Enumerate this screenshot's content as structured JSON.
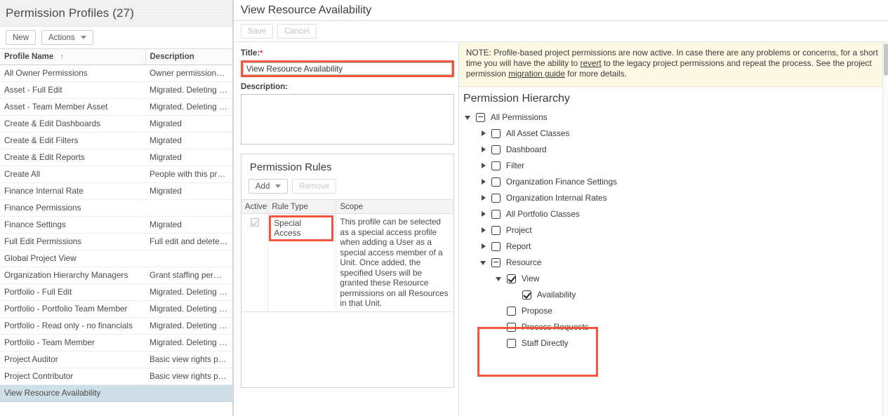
{
  "left": {
    "title": "Permission Profiles (27)",
    "toolbar": {
      "new_label": "New",
      "actions_label": "Actions"
    },
    "columns": {
      "name": "Profile Name",
      "description": "Description"
    },
    "sort_glyph": "↑",
    "rows": [
      {
        "name": "All Owner Permissions",
        "description": "Owner permissions that have been migrated and consolidated into a single profile."
      },
      {
        "name": "Asset - Full Edit",
        "description": "Migrated. Deleting this profile will result in asset sharing no longer working."
      },
      {
        "name": "Asset - Team Member Asset",
        "description": "Migrated. Deleting this profile will result in asset sharing no longer working."
      },
      {
        "name": "Create & Edit Dashboards",
        "description": "Migrated"
      },
      {
        "name": "Create & Edit Filters",
        "description": "Migrated"
      },
      {
        "name": "Create & Edit Reports",
        "description": "Migrated"
      },
      {
        "name": "Create All",
        "description": "People with this profile can create all Innotas entities."
      },
      {
        "name": "Finance Internal Rate",
        "description": "Migrated"
      },
      {
        "name": "Finance Permissions",
        "description": ""
      },
      {
        "name": "Finance Settings",
        "description": "Migrated"
      },
      {
        "name": "Full Edit Permissions",
        "description": "Full edit and delete permissions granted on entity types supported by enterprise p..."
      },
      {
        "name": "Global Project View",
        "description": ""
      },
      {
        "name": "Organization Hierarchy Managers",
        "description": "Grant staffing permissions for managers."
      },
      {
        "name": "Portfolio - Full Edit",
        "description": "Migrated. Deleting this profile will result in portfolio sharing no longer working."
      },
      {
        "name": "Portfolio - Portfolio Team Member",
        "description": "Migrated. Deleting this profile will result in portfolio sharing no longer working."
      },
      {
        "name": "Portfolio - Read only - no financials",
        "description": "Migrated. Deleting this profile will result in portfolio sharing no longer working."
      },
      {
        "name": "Portfolio - Team Member",
        "description": "Migrated. Deleting this profile will result in portfolio sharing no longer working."
      },
      {
        "name": "Project Auditor",
        "description": "Basic view rights plus can view Rollups section, Reports, Dashboards, and can crea..."
      },
      {
        "name": "Project Contributor",
        "description": "Basic view rights plus Reports and Dashboards, can create/edit Tasks and Issues/R..."
      },
      {
        "name": "View Resource Availability",
        "description": "",
        "selected": true
      }
    ]
  },
  "right": {
    "title": "View Resource Availability",
    "actions": {
      "save_label": "Save",
      "cancel_label": "Cancel"
    },
    "form": {
      "title_label": "Title:",
      "title_required_glyph": "*",
      "title_value": "View Resource Availability",
      "description_label": "Description:",
      "description_value": ""
    },
    "rules": {
      "heading": "Permission Rules",
      "add_label": "Add",
      "remove_label": "Remove",
      "columns": {
        "active": "Active",
        "rule_type": "Rule Type",
        "scope": "Scope"
      },
      "rows": [
        {
          "active": true,
          "rule_type": "Special Access",
          "scope": "This profile can be selected as a special access profile when adding a User as a special access member of a Unit. Once added, the specified Users will be granted these Resource permissions on all Resources in that Unit."
        }
      ]
    },
    "note": {
      "part1": "NOTE: Profile-based project permissions are now active. In case there are any problems or concerns, for a short time you will have the ability to ",
      "link1": "revert",
      "part2": " to the legacy project permissions and repeat the process. See the project permission ",
      "link2": "migration guide",
      "part3": " for more details."
    },
    "hierarchy": {
      "heading": "Permission Hierarchy",
      "nodes": [
        {
          "label": "All Permissions",
          "depth": 0,
          "twist": "open",
          "check": "partial"
        },
        {
          "label": "All Asset Classes",
          "depth": 1,
          "twist": "closed",
          "check": "empty"
        },
        {
          "label": "Dashboard",
          "depth": 1,
          "twist": "closed",
          "check": "empty"
        },
        {
          "label": "Filter",
          "depth": 1,
          "twist": "closed",
          "check": "empty"
        },
        {
          "label": "Organization Finance Settings",
          "depth": 1,
          "twist": "closed",
          "check": "empty"
        },
        {
          "label": "Organization Internal Rates",
          "depth": 1,
          "twist": "closed",
          "check": "empty"
        },
        {
          "label": "All Portfolio Classes",
          "depth": 1,
          "twist": "closed",
          "check": "empty"
        },
        {
          "label": "Project",
          "depth": 1,
          "twist": "closed",
          "check": "empty"
        },
        {
          "label": "Report",
          "depth": 1,
          "twist": "closed",
          "check": "empty"
        },
        {
          "label": "Resource",
          "depth": 1,
          "twist": "open",
          "check": "partial"
        },
        {
          "label": "View",
          "depth": 2,
          "twist": "open",
          "check": "checked"
        },
        {
          "label": "Availability",
          "depth": 3,
          "twist": "none",
          "check": "checked"
        },
        {
          "label": "Propose",
          "depth": 2,
          "twist": "none",
          "check": "empty"
        },
        {
          "label": "Process Requests",
          "depth": 2,
          "twist": "none",
          "check": "empty"
        },
        {
          "label": "Staff Directly",
          "depth": 2,
          "twist": "none",
          "check": "empty"
        }
      ]
    }
  },
  "colors": {
    "highlight": "#f4553d",
    "selected_row": "#cfdfe8",
    "note_bg": "#fdf8e3",
    "required": "#d33b2f"
  }
}
